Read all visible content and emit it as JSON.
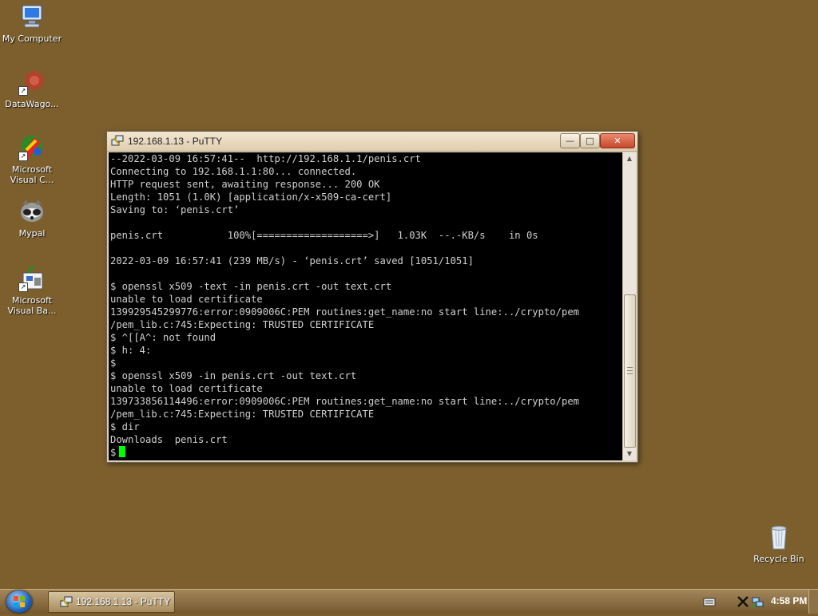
{
  "desktop": {
    "icons": [
      {
        "label": "My Computer",
        "icon": "computer-icon"
      },
      {
        "label": "DataWago...",
        "icon": "datawagon-icon"
      },
      {
        "label": "Microsoft\nVisual C...",
        "icon": "visual-c-icon"
      },
      {
        "label": "Mypal",
        "icon": "mypal-icon"
      },
      {
        "label": "Microsoft\nVisual Ba...",
        "icon": "visual-basic-icon"
      },
      {
        "label": "Recycle Bin",
        "icon": "recycle-bin-icon"
      }
    ]
  },
  "window": {
    "title": "192.168.1.13 - PuTTY",
    "min_glyph": "—",
    "max_glyph": "□",
    "close_glyph": "✕"
  },
  "terminal": {
    "lines": [
      "--2022-03-09 16:57:41--  http://192.168.1.1/penis.crt",
      "Connecting to 192.168.1.1:80... connected.",
      "HTTP request sent, awaiting response... 200 OK",
      "Length: 1051 (1.0K) [application/x-x509-ca-cert]",
      "Saving to: ‘penis.crt’",
      "",
      "penis.crt           100%[===================>]   1.03K  --.-KB/s    in 0s",
      "",
      "2022-03-09 16:57:41 (239 MB/s) - ‘penis.crt’ saved [1051/1051]",
      "",
      "$ openssl x509 -text -in penis.crt -out text.crt",
      "unable to load certificate",
      "139929545299776:error:0909006C:PEM routines:get_name:no start line:../crypto/pem",
      "/pem_lib.c:745:Expecting: TRUSTED CERTIFICATE",
      "$ ^[[A^: not found",
      "$ h: 4:",
      "$",
      "$ openssl x509 -in penis.crt -out text.crt",
      "unable to load certificate",
      "139733856114496:error:0909006C:PEM routines:get_name:no start line:../crypto/pem",
      "/pem_lib.c:745:Expecting: TRUSTED CERTIFICATE",
      "$ dir",
      "Downloads  penis.crt"
    ],
    "prompt": "$",
    "cursor_color": "#00ff00"
  },
  "scrollbar": {
    "up_arrow": "▲",
    "down_arrow": "▼"
  },
  "taskbar": {
    "start_icon": "windows-orb-icon",
    "tasks": [
      {
        "label": "192.168.1.13 - PuTTY",
        "icon": "putty-icon"
      }
    ],
    "clock": "4:58 PM"
  }
}
